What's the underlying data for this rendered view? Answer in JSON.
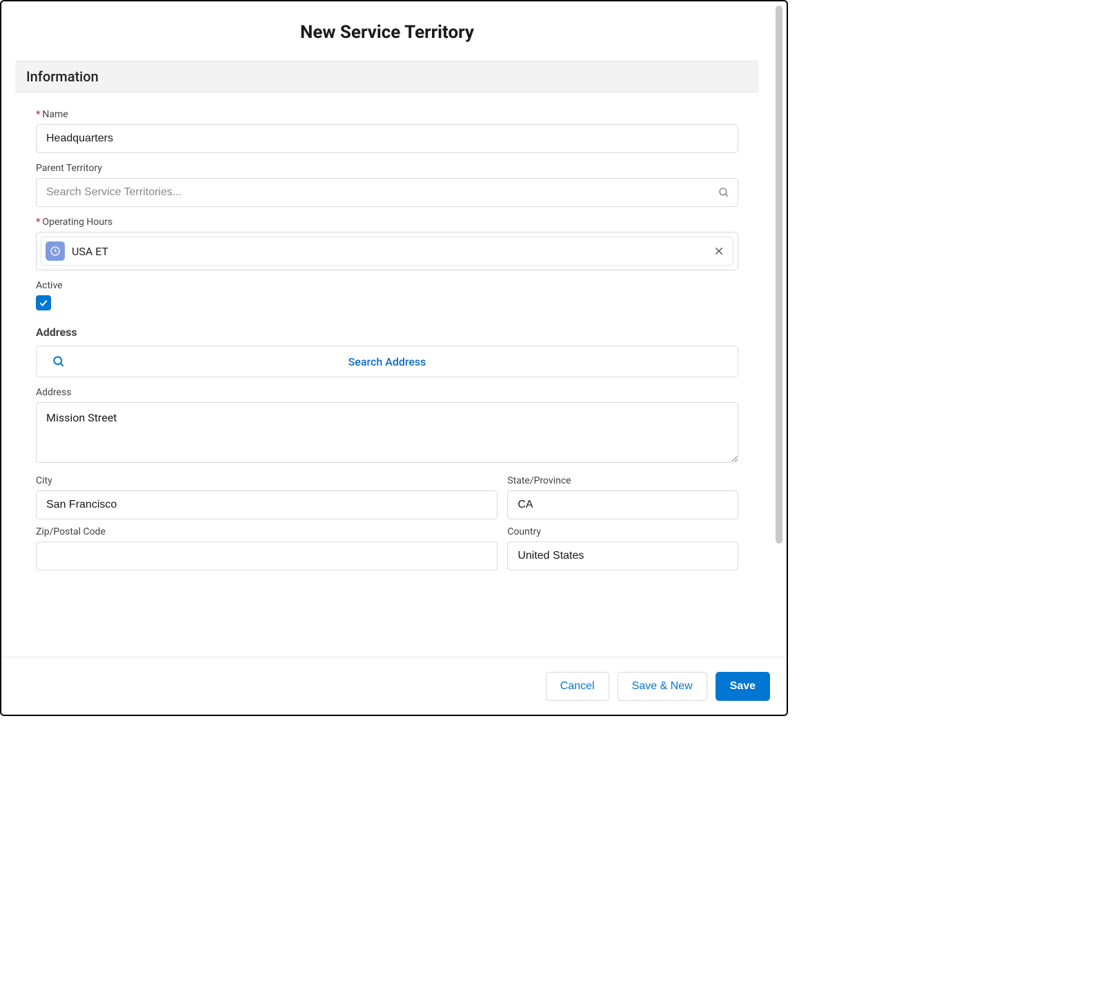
{
  "modal": {
    "title": "New Service Territory"
  },
  "sections": {
    "information": "Information"
  },
  "fields": {
    "name": {
      "label": "Name",
      "value": "Headquarters",
      "required": true
    },
    "parent_territory": {
      "label": "Parent Territory",
      "placeholder": "Search Service Territories...",
      "value": ""
    },
    "operating_hours": {
      "label": "Operating Hours",
      "value": "USA ET",
      "required": true
    },
    "active": {
      "label": "Active",
      "checked": true
    },
    "address_heading": "Address",
    "search_address_btn": "Search Address",
    "address": {
      "label": "Address",
      "value": "Mission Street"
    },
    "city": {
      "label": "City",
      "value": "San Francisco"
    },
    "state": {
      "label": "State/Province",
      "value": "CA"
    },
    "zip": {
      "label": "Zip/Postal Code",
      "value": ""
    },
    "country": {
      "label": "Country",
      "value": "United States"
    }
  },
  "footer": {
    "cancel": "Cancel",
    "save_new": "Save & New",
    "save": "Save"
  }
}
